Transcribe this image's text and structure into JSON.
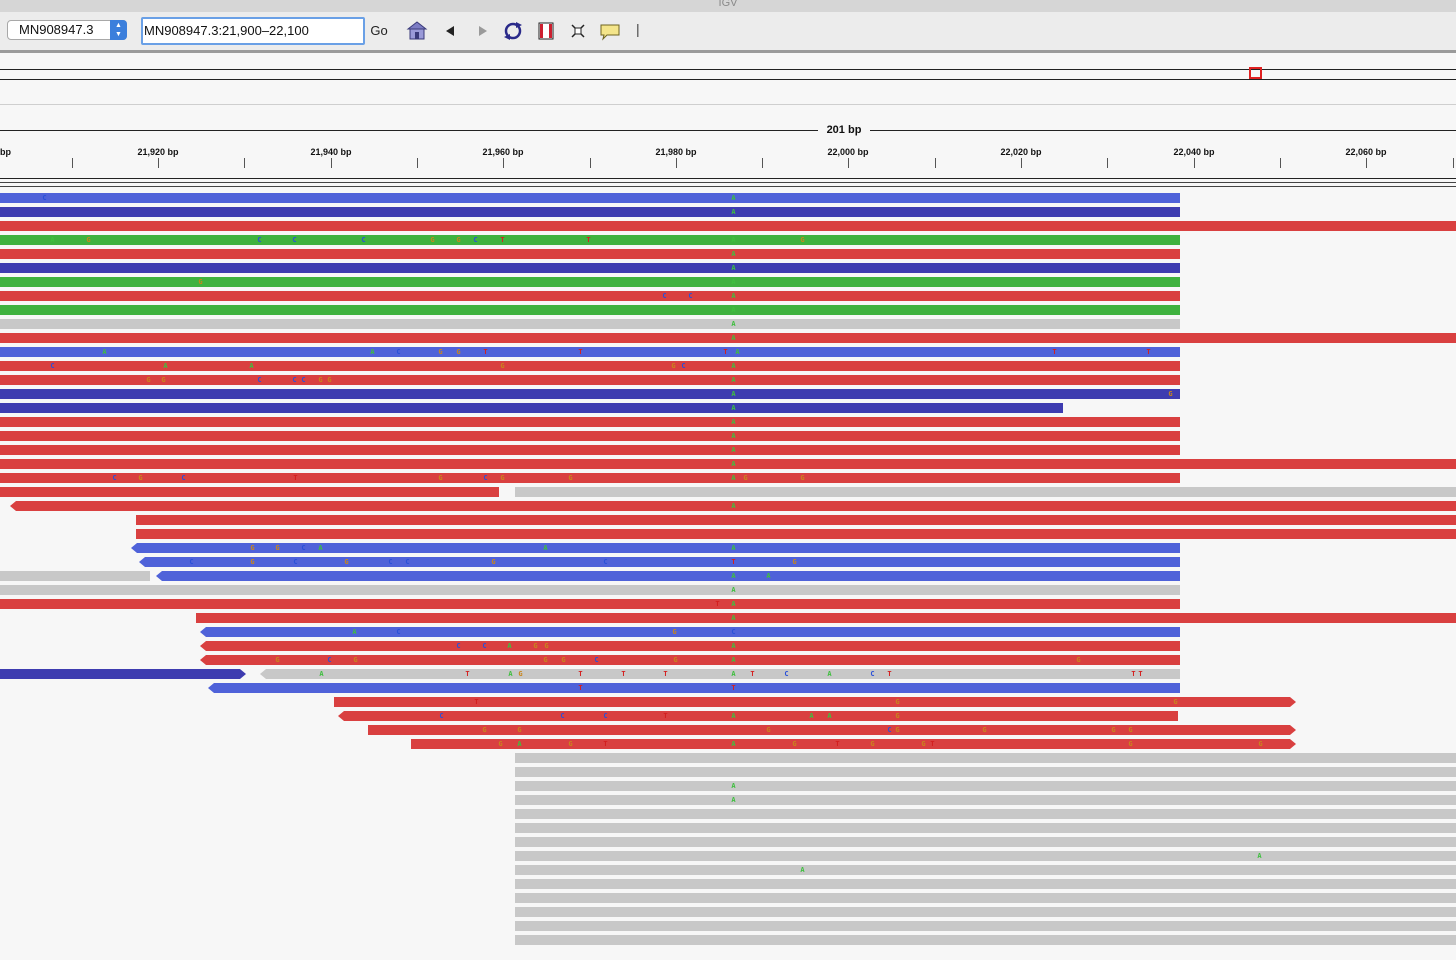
{
  "app": {
    "title": "IGV"
  },
  "toolbar": {
    "genome": "MN908947.3",
    "locus": "MN908947.3:21,900–22,100",
    "go_label": "Go",
    "divider": "|"
  },
  "ruler": {
    "span_label": "201 bp",
    "edge_label": "bp",
    "tick_labels": [
      "21,920 bp",
      "21,940 bp",
      "21,960 bp",
      "21,980 bp",
      "22,000 bp",
      "22,020 bp",
      "22,040 bp",
      "22,060 bp"
    ]
  },
  "colors": {
    "forward_read": "#d94040",
    "reverse_read": "#4f62d9",
    "reverse_read_dark": "#3e3cb0",
    "pair_read": "#3fb23f",
    "unpaired_read": "#c8c8c8",
    "base_A": "#3fbf3f",
    "base_C": "#2a50d8",
    "base_G": "#c8861c",
    "base_T": "#d42020",
    "region_marker": "#e02020"
  },
  "alignments": [
    {
      "start": 0,
      "end": 1180,
      "color": "reverse_read",
      "bases": [
        [
          "C",
          44
        ],
        [
          "A",
          733
        ]
      ]
    },
    {
      "start": 0,
      "end": 1180,
      "color": "reverse_read_dark",
      "bases": [
        [
          "A",
          733
        ]
      ]
    },
    {
      "start": 0,
      "end": 1456,
      "color": "forward_read",
      "bases": []
    },
    {
      "start": 0,
      "end": 1180,
      "color": "pair_read",
      "bases": [
        [
          "A",
          52
        ],
        [
          "G",
          88
        ],
        [
          "C",
          259
        ],
        [
          "C",
          294
        ],
        [
          "C",
          363
        ],
        [
          "G",
          432
        ],
        [
          "G",
          458
        ],
        [
          "C",
          475
        ],
        [
          "T",
          502
        ],
        [
          "T",
          588
        ],
        [
          "A",
          733
        ],
        [
          "G",
          802
        ]
      ]
    },
    {
      "start": 0,
      "end": 1180,
      "color": "forward_read",
      "bases": [
        [
          "A",
          733
        ]
      ]
    },
    {
      "start": 0,
      "end": 1180,
      "color": "reverse_read_dark",
      "bases": [
        [
          "A",
          733
        ]
      ]
    },
    {
      "start": 0,
      "end": 1180,
      "color": "pair_read",
      "bases": [
        [
          "G",
          200
        ],
        [
          "A",
          733
        ]
      ]
    },
    {
      "start": 0,
      "end": 1180,
      "color": "forward_read",
      "bases": [
        [
          "C",
          664
        ],
        [
          "C",
          690
        ],
        [
          "A",
          733
        ]
      ]
    },
    {
      "start": 0,
      "end": 1180,
      "color": "pair_read",
      "bases": [
        [
          "A",
          733
        ]
      ]
    },
    {
      "start": 0,
      "end": 1180,
      "color": "unpaired_read",
      "bases": [
        [
          "A",
          733
        ]
      ]
    },
    {
      "start": 0,
      "end": 1456,
      "color": "forward_read",
      "bases": [
        [
          "A",
          733
        ]
      ]
    },
    {
      "start": 0,
      "end": 1180,
      "color": "reverse_read",
      "bases": [
        [
          "A",
          104
        ],
        [
          "A",
          372
        ],
        [
          "C",
          398
        ],
        [
          "G",
          440
        ],
        [
          "G",
          458
        ],
        [
          "T",
          485
        ],
        [
          "T",
          580
        ],
        [
          "T",
          725
        ],
        [
          "A",
          737
        ],
        [
          "T",
          1054
        ],
        [
          "T",
          1148
        ]
      ]
    },
    {
      "start": 0,
      "end": 1180,
      "color": "forward_read",
      "bases": [
        [
          "C",
          52
        ],
        [
          "A",
          165
        ],
        [
          "A",
          251
        ],
        [
          "G",
          502
        ],
        [
          "G",
          673
        ],
        [
          "C",
          683
        ],
        [
          "A",
          733
        ]
      ]
    },
    {
      "start": 0,
      "end": 1180,
      "color": "forward_read",
      "bases": [
        [
          "G",
          148
        ],
        [
          "G",
          163
        ],
        [
          "C",
          259
        ],
        [
          "C",
          294
        ],
        [
          "C",
          303
        ],
        [
          "G",
          320
        ],
        [
          "G",
          329
        ],
        [
          "A",
          733
        ]
      ]
    },
    {
      "start": 0,
      "end": 1180,
      "color": "reverse_read_dark",
      "bases": [
        [
          "A",
          733
        ],
        [
          "G",
          1170
        ]
      ]
    },
    {
      "start": 0,
      "end": 1063,
      "color": "reverse_read_dark",
      "bases": [
        [
          "A",
          733
        ]
      ]
    },
    {
      "start": 0,
      "end": 1180,
      "color": "forward_read",
      "bases": [
        [
          "A",
          733
        ]
      ]
    },
    {
      "start": 0,
      "end": 1180,
      "color": "forward_read",
      "bases": [
        [
          "A",
          733
        ]
      ]
    },
    {
      "start": 0,
      "end": 1180,
      "color": "forward_read",
      "bases": [
        [
          "A",
          733
        ]
      ]
    },
    {
      "start": 0,
      "end": 1456,
      "color": "forward_read",
      "bases": [
        [
          "A",
          733
        ]
      ]
    },
    {
      "start": 0,
      "end": 1180,
      "color": "forward_read",
      "bases": [
        [
          "C",
          114
        ],
        [
          "G",
          140
        ],
        [
          "C",
          183
        ],
        [
          "T",
          295
        ],
        [
          "G",
          440
        ],
        [
          "C",
          485
        ],
        [
          "G",
          502
        ],
        [
          "G",
          570
        ],
        [
          "A",
          733
        ],
        [
          "G",
          745
        ],
        [
          "G",
          802
        ]
      ]
    },
    {
      "start": 0,
      "end": 499,
      "color": "forward_read",
      "bases": []
    },
    {
      "start": 515,
      "end": 1456,
      "color": "unpaired_read",
      "bases": []
    },
    {
      "start": 10,
      "end": 1456,
      "color": "forward_read",
      "arrow": "left",
      "bases": [
        [
          "A",
          733
        ]
      ]
    },
    {
      "start": 136,
      "end": 1456,
      "color": "forward_read",
      "bases": []
    },
    {
      "start": 136,
      "end": 1456,
      "color": "forward_read",
      "bases": []
    },
    {
      "start": 131,
      "end": 1180,
      "color": "reverse_read",
      "arrow": "left",
      "bases": [
        [
          "G",
          252
        ],
        [
          "G",
          277
        ],
        [
          "C",
          303
        ],
        [
          "A",
          320
        ],
        [
          "A",
          545
        ],
        [
          "A",
          733
        ]
      ]
    },
    {
      "start": 139,
      "end": 1180,
      "color": "reverse_read",
      "arrow": "left",
      "bases": [
        [
          "C",
          191
        ],
        [
          "G",
          252
        ],
        [
          "C",
          295
        ],
        [
          "G",
          346
        ],
        [
          "C",
          390
        ],
        [
          "C",
          407
        ],
        [
          "G",
          493
        ],
        [
          "C",
          605
        ],
        [
          "T",
          733
        ],
        [
          "G",
          794
        ]
      ]
    },
    {
      "start": 0,
      "end": 150,
      "color": "unpaired_read",
      "bases": []
    },
    {
      "start": 156,
      "end": 1180,
      "color": "reverse_read",
      "arrow": "left",
      "bases": [
        [
          "A",
          733
        ],
        [
          "A",
          768
        ]
      ]
    },
    {
      "start": 0,
      "end": 1180,
      "color": "unpaired_read",
      "bases": [
        [
          "A",
          733
        ]
      ]
    },
    {
      "start": 0,
      "end": 1180,
      "color": "forward_read",
      "bases": [
        [
          "T",
          717
        ],
        [
          "A",
          733
        ]
      ]
    },
    {
      "start": 196,
      "end": 1456,
      "color": "forward_read",
      "bases": [
        [
          "A",
          733
        ]
      ]
    },
    {
      "start": 200,
      "end": 1180,
      "color": "reverse_read",
      "arrow": "left",
      "bases": [
        [
          "A",
          354
        ],
        [
          "C",
          398
        ],
        [
          "G",
          674
        ],
        [
          "C",
          733
        ]
      ]
    },
    {
      "start": 200,
      "end": 1180,
      "color": "forward_read",
      "arrow": "left",
      "bases": [
        [
          "C",
          458
        ],
        [
          "C",
          484
        ],
        [
          "A",
          509
        ],
        [
          "G",
          535
        ],
        [
          "G",
          546
        ],
        [
          "A",
          733
        ]
      ]
    },
    {
      "start": 200,
      "end": 1180,
      "color": "forward_read",
      "arrow": "left",
      "bases": [
        [
          "G",
          277
        ],
        [
          "C",
          329
        ],
        [
          "G",
          355
        ],
        [
          "G",
          545
        ],
        [
          "G",
          563
        ],
        [
          "C",
          596
        ],
        [
          "G",
          675
        ],
        [
          "A",
          733
        ],
        [
          "G",
          1078
        ]
      ]
    },
    {
      "start": 0,
      "end": 246,
      "color": "reverse_read_dark",
      "arrow": "right",
      "bases": []
    },
    {
      "start": 260,
      "end": 1180,
      "color": "unpaired_read",
      "arrow": "left",
      "bases": [
        [
          "A",
          321
        ],
        [
          "T",
          467
        ],
        [
          "A",
          510
        ],
        [
          "G",
          520
        ],
        [
          "T",
          580
        ],
        [
          "T",
          623
        ],
        [
          "T",
          665
        ],
        [
          "A",
          733
        ],
        [
          "T",
          752
        ],
        [
          "C",
          786
        ],
        [
          "A",
          829
        ],
        [
          "C",
          872
        ],
        [
          "T",
          889
        ],
        [
          "T",
          1133
        ],
        [
          "T",
          1140
        ]
      ]
    },
    {
      "start": 208,
      "end": 1180,
      "color": "reverse_read",
      "arrow": "left",
      "bases": [
        [
          "T",
          580
        ],
        [
          "T",
          733
        ]
      ]
    },
    {
      "start": 334,
      "end": 1296,
      "color": "forward_read",
      "arrow": "right",
      "bases": [
        [
          "T",
          476
        ],
        [
          "G",
          897
        ],
        [
          "G",
          1175
        ]
      ]
    },
    {
      "start": 338,
      "end": 1178,
      "color": "forward_read",
      "arrow": "left",
      "bases": [
        [
          "C",
          441
        ],
        [
          "C",
          562
        ],
        [
          "C",
          605
        ],
        [
          "T",
          665
        ],
        [
          "A",
          733
        ],
        [
          "A",
          811
        ],
        [
          "A",
          829
        ],
        [
          "G",
          897
        ]
      ]
    },
    {
      "start": 368,
      "end": 1296,
      "color": "forward_read",
      "arrow": "right",
      "bases": [
        [
          "G",
          484
        ],
        [
          "G",
          519
        ],
        [
          "G",
          768
        ],
        [
          "C",
          889
        ],
        [
          "G",
          897
        ],
        [
          "G",
          984
        ],
        [
          "G",
          1113
        ],
        [
          "G",
          1130
        ]
      ]
    },
    {
      "start": 411,
      "end": 1296,
      "color": "forward_read",
      "arrow": "right",
      "bases": [
        [
          "G",
          500
        ],
        [
          "A",
          519
        ],
        [
          "G",
          570
        ],
        [
          "T",
          605
        ],
        [
          "A",
          733
        ],
        [
          "G",
          794
        ],
        [
          "T",
          837
        ],
        [
          "G",
          872
        ],
        [
          "G",
          923
        ],
        [
          "T",
          932
        ],
        [
          "G",
          1130
        ],
        [
          "G",
          1260
        ]
      ]
    },
    {
      "start": 515,
      "end": 1456,
      "color": "unpaired_read",
      "bases": []
    },
    {
      "start": 515,
      "end": 1456,
      "color": "unpaired_read",
      "bases": []
    },
    {
      "start": 515,
      "end": 1456,
      "color": "unpaired_read",
      "bases": [
        [
          "A",
          733
        ]
      ]
    },
    {
      "start": 515,
      "end": 1456,
      "color": "unpaired_read",
      "bases": [
        [
          "A",
          733
        ]
      ]
    },
    {
      "start": 515,
      "end": 1456,
      "color": "unpaired_read",
      "bases": []
    },
    {
      "start": 515,
      "end": 1456,
      "color": "unpaired_read",
      "bases": []
    },
    {
      "start": 515,
      "end": 1456,
      "color": "unpaired_read",
      "bases": []
    },
    {
      "start": 515,
      "end": 1456,
      "color": "unpaired_read",
      "bases": [
        [
          "A",
          1259
        ]
      ]
    },
    {
      "start": 515,
      "end": 1456,
      "color": "unpaired_read",
      "bases": [
        [
          "A",
          802
        ]
      ]
    },
    {
      "start": 515,
      "end": 1456,
      "color": "unpaired_read",
      "bases": []
    },
    {
      "start": 515,
      "end": 1456,
      "color": "unpaired_read",
      "bases": []
    },
    {
      "start": 515,
      "end": 1456,
      "color": "unpaired_read",
      "bases": []
    },
    {
      "start": 515,
      "end": 1456,
      "color": "unpaired_read",
      "bases": []
    },
    {
      "start": 515,
      "end": 1456,
      "color": "unpaired_read",
      "bases": []
    }
  ]
}
